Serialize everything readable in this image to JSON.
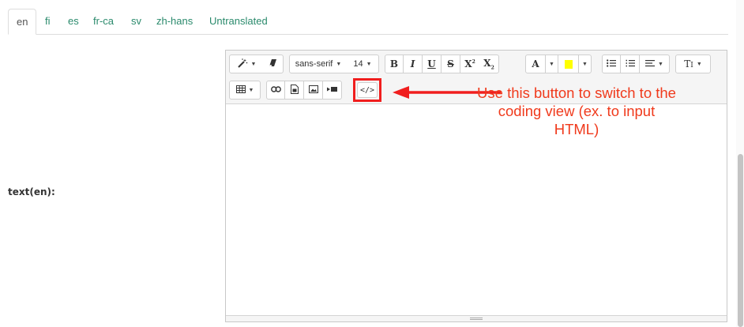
{
  "language_tabs": [
    {
      "label": "en",
      "active": true
    },
    {
      "label": "fi",
      "active": false
    },
    {
      "label": "es",
      "active": false
    },
    {
      "label": "fr-ca",
      "active": false
    },
    {
      "label": "sv",
      "active": false
    },
    {
      "label": "zh-hans",
      "active": false
    },
    {
      "label": "Untranslated",
      "active": false
    }
  ],
  "field": {
    "label": "text(en):"
  },
  "toolbar": {
    "font_family": "sans-serif",
    "font_size": "14",
    "bold": "B",
    "italic": "I",
    "underline": "U",
    "strikethrough": "S",
    "superscript": "X",
    "subscript": "X",
    "font_color": "A",
    "style": "T",
    "code_view": "</>"
  },
  "annotation": {
    "text": "Use this button to switch to the coding view (ex. to input HTML)",
    "color": "#f03a1c"
  },
  "colors": {
    "accent_link": "#2a8a6c",
    "highlight": "#ffff00",
    "annotation_red": "#f01e1e"
  }
}
